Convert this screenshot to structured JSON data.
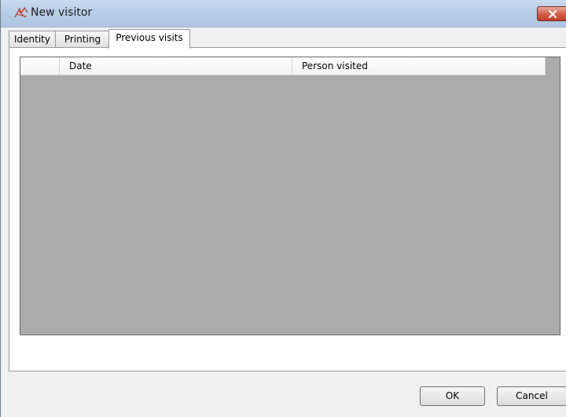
{
  "window": {
    "title": "New visitor",
    "icon": "visitor-app-icon",
    "close_icon": "close-icon",
    "accent_close": "#c0402c"
  },
  "tabs": [
    {
      "label": "Identity",
      "active": false
    },
    {
      "label": "Printing",
      "active": false
    },
    {
      "label": "Previous visits",
      "active": true
    }
  ],
  "visits_grid": {
    "columns": [
      "",
      "Date",
      "Person visited"
    ],
    "rows": [],
    "background": "#ababab"
  },
  "buttons": {
    "ok_label": "OK",
    "cancel_label": "Cancel"
  }
}
